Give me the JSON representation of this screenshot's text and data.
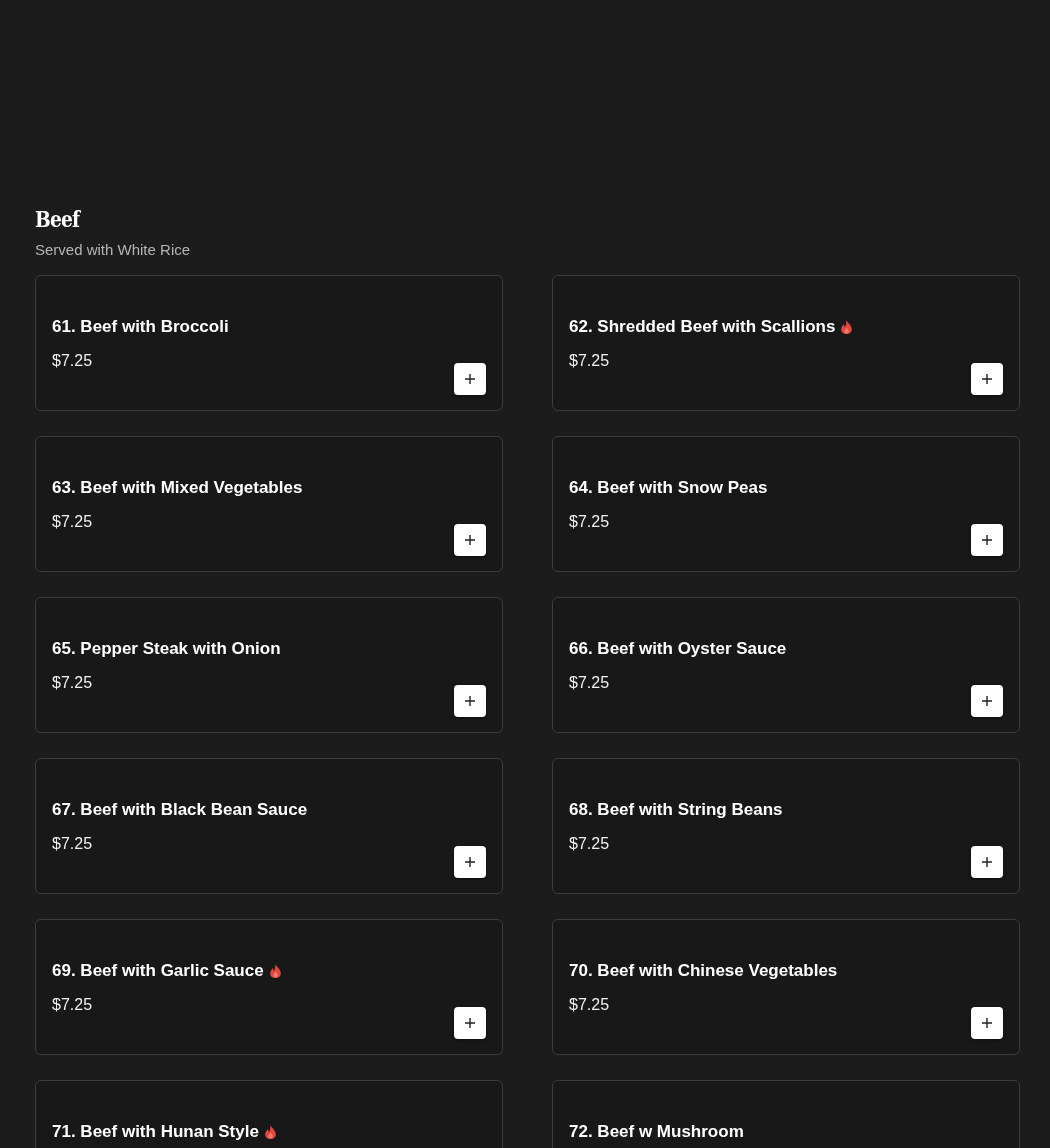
{
  "category": {
    "title": "Beef",
    "subtitle": "Served with White Rice"
  },
  "items": [
    {
      "name": "61. Beef with Broccoli",
      "price": "$7.25",
      "spicy": false
    },
    {
      "name": "62. Shredded Beef with Scallions",
      "price": "$7.25",
      "spicy": true
    },
    {
      "name": "63. Beef with Mixed Vegetables",
      "price": "$7.25",
      "spicy": false
    },
    {
      "name": "64. Beef with Snow Peas",
      "price": "$7.25",
      "spicy": false
    },
    {
      "name": "65. Pepper Steak with Onion",
      "price": "$7.25",
      "spicy": false
    },
    {
      "name": "66. Beef with Oyster Sauce",
      "price": "$7.25",
      "spicy": false
    },
    {
      "name": "67. Beef with Black Bean Sauce",
      "price": "$7.25",
      "spicy": false
    },
    {
      "name": "68. Beef with String Beans",
      "price": "$7.25",
      "spicy": false
    },
    {
      "name": "69. Beef with Garlic Sauce",
      "price": "$7.25",
      "spicy": true
    },
    {
      "name": "70. Beef with Chinese Vegetables",
      "price": "$7.25",
      "spicy": false
    },
    {
      "name": "71. Beef with Hunan Style",
      "spicy": true
    },
    {
      "name": "72. Beef w Mushroom",
      "spicy": false
    }
  ]
}
